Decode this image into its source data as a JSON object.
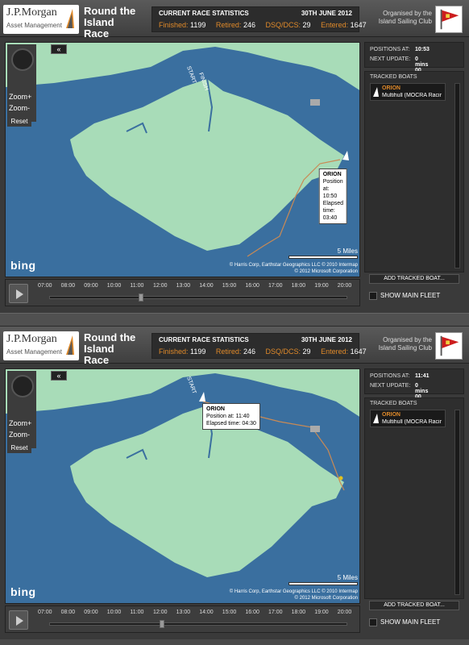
{
  "branding": {
    "company": "J.P.Morgan",
    "division": "Asset Management",
    "race_name": "Round the Island Race",
    "organiser": "Organised by the Island Sailing Club"
  },
  "stats": {
    "heading": "CURRENT RACE STATISTICS",
    "date": "30TH JUNE 2012",
    "finished_label": "Finished:",
    "finished": "1199",
    "retired_label": "Retired:",
    "retired": "246",
    "dsq_label": "DSQ/DCS:",
    "dsq": "29",
    "entered_label": "Entered:",
    "entered": "1647"
  },
  "map_controls": {
    "zoom_in": "Zoom+",
    "zoom_out": "Zoom-",
    "reset": "Reset",
    "collapse": "«"
  },
  "map": {
    "bing": "bing",
    "scale": "5 Miles",
    "copyright_1": "© Harris Corp, Earthstar Geographics LLC  © 2010 Intermap",
    "copyright_2": "© 2012 Microsoft Corporation",
    "start_label": "START",
    "finish_label": "FINISH",
    "water_color": "#3a6f9f",
    "land_color": "#a8dcb8"
  },
  "timeline": {
    "hours": [
      "07:00",
      "08:00",
      "09:00",
      "10:00",
      "11:00",
      "12:00",
      "13:00",
      "14:00",
      "15:00",
      "16:00",
      "17:00",
      "18:00",
      "19:00",
      "20:00"
    ]
  },
  "sidebar": {
    "positions_at_label": "POSITIONS AT:",
    "next_update_label": "NEXT UPDATE:",
    "next_update": "0 mins 00 secs",
    "tracked_heading": "TRACKED BOATS",
    "boat_name": "ORION",
    "boat_class": "Multihull (MOCRA Racir",
    "add_button": "ADD TRACKED BOAT...",
    "show_fleet": "SHOW MAIN FLEET"
  },
  "frames": [
    {
      "positions_at": "10:53",
      "timeline_progress": 0.3,
      "tooltip": {
        "name": "ORION",
        "position": "Position at:  10:50",
        "elapsed": "Elapsed time:  03:40"
      }
    },
    {
      "positions_at": "11:41",
      "timeline_progress": 0.37,
      "tooltip": {
        "name": "ORION",
        "position": "Position at:  11:40",
        "elapsed": "Elapsed time:  04:30"
      }
    }
  ],
  "colors": {
    "accent_orange": "#e08a2a",
    "track_line": "#c98a55"
  }
}
